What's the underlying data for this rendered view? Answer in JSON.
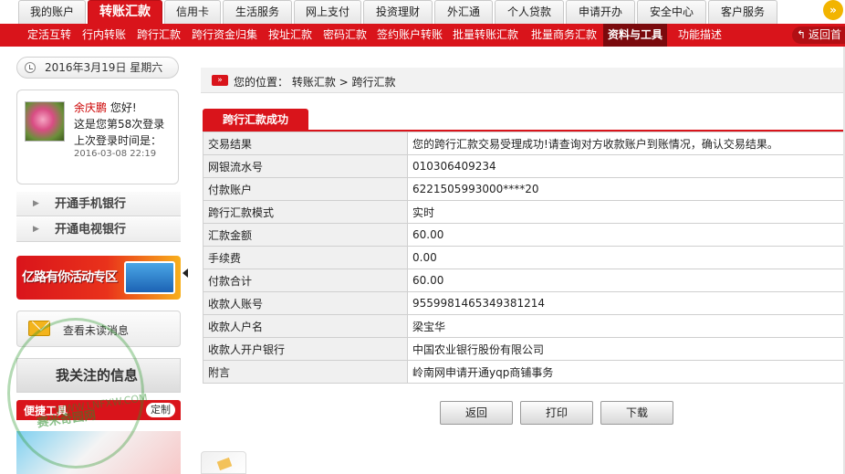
{
  "topnav": {
    "tabs": [
      "我的账户",
      "转账汇款",
      "信用卡",
      "生活服务",
      "网上支付",
      "投资理财",
      "外汇通",
      "个人贷款",
      "申请开办",
      "安全中心",
      "客户服务"
    ],
    "active": "转账汇款",
    "more_glyph": "»"
  },
  "subnav": {
    "items": [
      "定活互转",
      "行内转账",
      "跨行汇款",
      "跨行资金归集",
      "按址汇款",
      "密码汇款",
      "签约账户转账",
      "批量转账汇款",
      "批量商务汇款",
      "资料与工具",
      "功能描述"
    ],
    "active": "资料与工具",
    "back_label": "返回首"
  },
  "sidebar": {
    "date": "2016年3月19日 星期六",
    "user": {
      "name": "余庆鹏",
      "greeting": "您好!",
      "login_count": "这是您第58次登录",
      "last_login_label": "上次登录时间是：",
      "last_login_time": "2016-03-08 22:19"
    },
    "menu": [
      "开通手机银行",
      "开通电视银行"
    ],
    "promo_text": "亿路有你活动专区",
    "messages_label": "查看未读消息",
    "focus_label": "我关注的信息",
    "quickbar": {
      "title": "便捷工具",
      "button": "定制"
    }
  },
  "watermark": {
    "text": "赛米奇园网",
    "url": "WWW.LNFXW.COM"
  },
  "main": {
    "breadcrumb_icon": "»",
    "breadcrumb": "您的位置： 转账汇款 > 跨行汇款",
    "section_title": "跨行汇款成功",
    "rows": [
      {
        "label": "交易结果",
        "value": "您的跨行汇款交易受理成功!请查询对方收款账户到账情况，确认交易结果。"
      },
      {
        "label": "网银流水号",
        "value": "010306409234"
      },
      {
        "label": "付款账户",
        "value": "6221505993000****20"
      },
      {
        "label": "跨行汇款模式",
        "value": "实时"
      },
      {
        "label": "汇款金额",
        "value": "60.00"
      },
      {
        "label": "手续费",
        "value": "0.00"
      },
      {
        "label": "付款合计",
        "value": "60.00"
      },
      {
        "label": "收款人账号",
        "value": "9559981465349381214"
      },
      {
        "label": "收款人户名",
        "value": "梁宝华"
      },
      {
        "label": "收款人开户银行",
        "value": "中国农业银行股份有限公司"
      },
      {
        "label": "附言",
        "value": "岭南网申请开通yqp商铺事务"
      }
    ],
    "buttons": {
      "back": "返回",
      "print": "打印",
      "download": "下载"
    }
  },
  "colors": {
    "brand_red": "#d9141b",
    "dark_red": "#7a0a0d"
  }
}
